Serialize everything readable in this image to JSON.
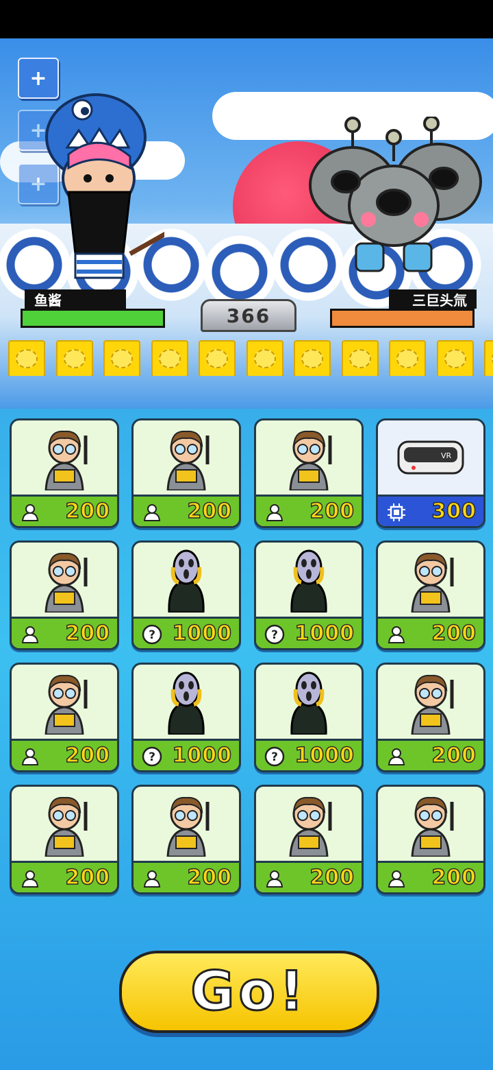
{
  "player": {
    "name": "鱼酱",
    "hp_fraction": 1.0,
    "hp_color": "#4fd13a"
  },
  "enemy": {
    "name": "三巨头氚",
    "hp_fraction": 1.0,
    "hp_color": "#f08a3c"
  },
  "score": "366",
  "side_buttons": [
    {
      "icon": "plus-icon",
      "active": true
    },
    {
      "icon": "plus-icon",
      "active": false
    },
    {
      "icon": "plus-icon",
      "active": false
    }
  ],
  "coin_count_visible": 11,
  "cards": [
    {
      "art": "scientist",
      "icon": "person-icon",
      "price": "200",
      "theme": "green"
    },
    {
      "art": "scientist",
      "icon": "person-icon",
      "price": "200",
      "theme": "green"
    },
    {
      "art": "scientist",
      "icon": "person-icon",
      "price": "200",
      "theme": "green"
    },
    {
      "art": "vr-headset",
      "art_label": "VR",
      "icon": "chip-icon",
      "price": "300",
      "theme": "blue"
    },
    {
      "art": "scientist",
      "icon": "person-icon",
      "price": "200",
      "theme": "green"
    },
    {
      "art": "scream-figure",
      "icon": "question-icon",
      "price": "1000",
      "theme": "green"
    },
    {
      "art": "scream-figure",
      "icon": "question-icon",
      "price": "1000",
      "theme": "green"
    },
    {
      "art": "scientist",
      "icon": "person-icon",
      "price": "200",
      "theme": "green"
    },
    {
      "art": "scientist",
      "icon": "person-icon",
      "price": "200",
      "theme": "green"
    },
    {
      "art": "scream-figure",
      "icon": "question-icon",
      "price": "1000",
      "theme": "green"
    },
    {
      "art": "scream-figure",
      "icon": "question-icon",
      "price": "1000",
      "theme": "green"
    },
    {
      "art": "scientist",
      "icon": "person-icon",
      "price": "200",
      "theme": "green"
    },
    {
      "art": "scientist",
      "icon": "person-icon",
      "price": "200",
      "theme": "green"
    },
    {
      "art": "scientist",
      "icon": "person-icon",
      "price": "200",
      "theme": "green"
    },
    {
      "art": "scientist",
      "icon": "person-icon",
      "price": "200",
      "theme": "green"
    },
    {
      "art": "scientist",
      "icon": "person-icon",
      "price": "200",
      "theme": "green"
    }
  ],
  "go_button": {
    "label": "Go!"
  }
}
